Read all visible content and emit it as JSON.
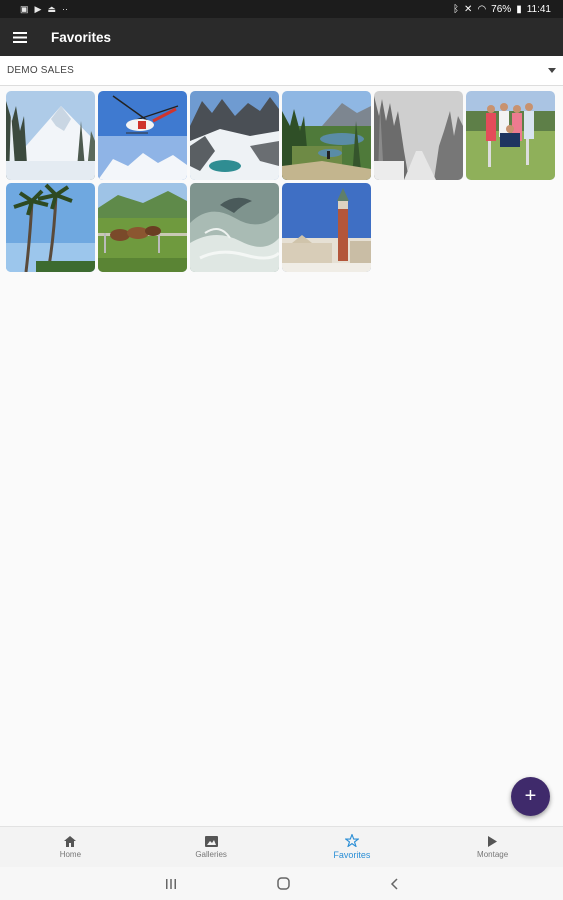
{
  "status_bar": {
    "right_text": "76%",
    "time": "11:41"
  },
  "app_bar": {
    "title": "Favorites",
    "menu_icon": "hamburger-menu-icon"
  },
  "dropdown": {
    "selected": "DEMO SALES"
  },
  "gallery": {
    "photos": [
      {
        "subject": "snowy-mountain-trees"
      },
      {
        "subject": "helicopter-over-snow"
      },
      {
        "subject": "alpine-lake-peaks"
      },
      {
        "subject": "mountain-lake-hiker"
      },
      {
        "subject": "snowy-forest-road"
      },
      {
        "subject": "golf-group"
      },
      {
        "subject": "palm-trees"
      },
      {
        "subject": "horses-field"
      },
      {
        "subject": "dolphin-wave"
      },
      {
        "subject": "venice-campanile"
      }
    ]
  },
  "fab": {
    "label": "+",
    "icon": "plus-icon"
  },
  "bottom_nav": {
    "items": [
      {
        "label": "Home",
        "icon": "home-icon",
        "active": false
      },
      {
        "label": "Galleries",
        "icon": "image-icon",
        "active": false
      },
      {
        "label": "Favorites",
        "icon": "star-icon",
        "active": true
      },
      {
        "label": "Montage",
        "icon": "play-icon",
        "active": false
      }
    ]
  },
  "colors": {
    "app_bar": "#2a2a2a",
    "fab": "#3f2a6b",
    "active_nav": "#2c8fd6"
  }
}
